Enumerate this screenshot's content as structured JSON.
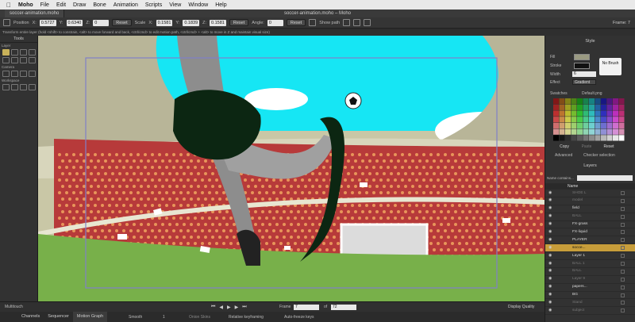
{
  "menubar": {
    "app": "Moho",
    "items": [
      "File",
      "Edit",
      "Draw",
      "Bone",
      "Animation",
      "Scripts",
      "View",
      "Window",
      "Help"
    ]
  },
  "titlebar": {
    "doc_tab": "soccer-animation.moho",
    "window_title": "soccer-animation.moho – Moho"
  },
  "toolbar": {
    "position_label": "Position",
    "x_label": "X:",
    "x_value": "0.5727",
    "y_label": "Y:",
    "y_value": "0.6340",
    "z_label": "Z:",
    "z_value": "0",
    "reset1": "Reset",
    "scale_label": "Scale",
    "sx_label": "X:",
    "sx_value": "0.1581",
    "sy_label": "Y:",
    "sy_value": "0.1839",
    "sz_label": "Z:",
    "sz_value": "0.1581",
    "reset2": "Reset",
    "angle_label": "Angle:",
    "angle_value": "0",
    "reset3": "Reset",
    "show_path": "Show path",
    "frame_indicator": "Frame: 7"
  },
  "hint": "Transform entire layer (hold <shift> to constrain, <alt> to move forward and back, <ctrl/cmd> to edit motion path, <ctrl/cmd> + <alt> to move in Z and maintain visual size)",
  "tools": {
    "title": "Tools",
    "sections": [
      "Layer",
      "Camera",
      "Workspace"
    ]
  },
  "style": {
    "title": "Style",
    "fill_label": "Fill",
    "stroke_label": "Stroke",
    "width_label": "Width",
    "width_value": "6",
    "effect_label": "Effect",
    "effect_value": "Gradient",
    "no_brush": "No Brush",
    "swatches_label": "Swatches",
    "swatches_file": "Default.png",
    "copy": "Copy",
    "paste": "Paste",
    "reset": "Reset",
    "advanced": "Advanced",
    "checker": "Checker selection"
  },
  "layers": {
    "title": "Layers",
    "filter_label": "Name contains...",
    "name_col": "Name",
    "rows": [
      {
        "name": "SHOE L",
        "dim": true,
        "sel": false
      },
      {
        "name": "model",
        "dim": true,
        "sel": false
      },
      {
        "name": "field",
        "dim": false,
        "sel": false
      },
      {
        "name": "BALL",
        "dim": true,
        "sel": false
      },
      {
        "name": "FX-grass",
        "dim": false,
        "sel": false
      },
      {
        "name": "FX-liquid",
        "dim": false,
        "sel": false
      },
      {
        "name": "PLAYER",
        "dim": false,
        "sel": false
      },
      {
        "name": "socce...",
        "dim": false,
        "sel": true
      },
      {
        "name": "Layer 1",
        "dim": false,
        "sel": false
      },
      {
        "name": "BALL 1",
        "dim": true,
        "sel": false
      },
      {
        "name": "BALL",
        "dim": true,
        "sel": false
      },
      {
        "name": "Layer 9",
        "dim": true,
        "sel": false
      },
      {
        "name": "papers...",
        "dim": false,
        "sel": false
      },
      {
        "name": "BG",
        "dim": false,
        "sel": false
      },
      {
        "name": "Stand",
        "dim": true,
        "sel": false
      },
      {
        "name": "subject",
        "dim": true,
        "sel": false
      }
    ]
  },
  "timeline": {
    "multitouch": "Multitouch",
    "frame_label": "Frame",
    "frame_value": "7",
    "of_label": "of",
    "total_value": "72",
    "display_quality": "Display Quality"
  },
  "bottom": {
    "tabs": [
      "Channels",
      "Sequencer",
      "Motion Graph"
    ],
    "smooth": "Smooth",
    "smooth_num": "1",
    "onion": "Onion Skins",
    "relative": "Relative keyframing",
    "autofreeze": "Auto-freeze keys"
  },
  "colors": {
    "sky": "#16e6f4",
    "crowd": "#b73a3a",
    "grass": "#78b04a",
    "selection": "#c79d3a",
    "frame_guide": "#8080c8"
  }
}
